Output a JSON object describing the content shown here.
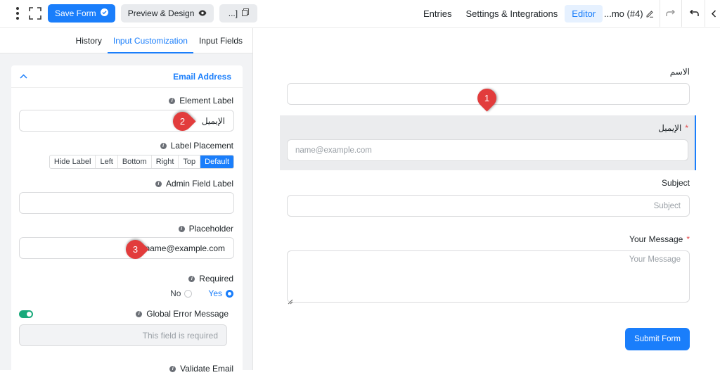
{
  "topbar": {
    "save_label": "Save Form",
    "preview_label": "Preview & Design",
    "shortcode_label": "...]",
    "nav": [
      "Entries",
      "Settings & Integrations",
      "Editor"
    ],
    "form_title": "...mo (#4)"
  },
  "left_panel": {
    "tabs": [
      "History",
      "Input Customization",
      "Input Fields"
    ],
    "card_title": "Email Address",
    "element_label": {
      "label": "Element Label",
      "value": "الإيميل"
    },
    "label_placement": {
      "label": "Label Placement",
      "options": [
        "Hide Label",
        "Left",
        "Bottom",
        "Right",
        "Top",
        "Default"
      ],
      "selected": "Default"
    },
    "admin_field_label": {
      "label": "Admin Field Label",
      "value": ""
    },
    "placeholder": {
      "label": "Placeholder",
      "value": "name@example.com"
    },
    "required": {
      "label": "Required",
      "no": "No",
      "yes": "Yes",
      "selected": "Yes"
    },
    "global_error": {
      "label": "Global Error Message",
      "placeholder": "This field is required"
    },
    "validate_email": {
      "label": "Validate Email"
    }
  },
  "form": {
    "name_label": "الاسم",
    "email_label": "الإيميل",
    "email_placeholder": "name@example.com",
    "subject_label": "Subject",
    "subject_placeholder": "Subject",
    "message_label": "Your Message",
    "message_placeholder": "Your Message",
    "submit_label": "Submit Form",
    "required_mark": "*"
  },
  "callouts": [
    "1",
    "2",
    "3"
  ],
  "colors": {
    "accent": "#1a7efb",
    "callout": "#e23c3c",
    "toggle_on": "#19a97b",
    "required": "#e34b4b"
  }
}
